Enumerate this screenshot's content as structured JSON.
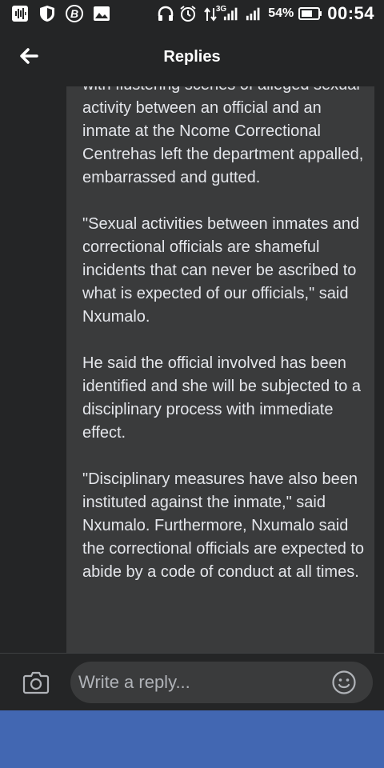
{
  "status_bar": {
    "network": "3G",
    "battery": "54%",
    "time": "00:54",
    "left_icons": [
      "sound-wave-icon",
      "shield-icon",
      "bitcoin-icon",
      "image-icon"
    ],
    "right_icons": [
      "headphones-icon",
      "alarm-icon",
      "data-arrows-icon",
      "signal-icon",
      "battery-icon"
    ]
  },
  "header": {
    "title": "Replies",
    "back_icon": "back-arrow-icon"
  },
  "comment": {
    "paragraphs": [
      "with flustering scenes of alleged sexual activity between an official and an inmate at the Ncome Correctional Centrehas left the department appalled, embarrassed and gutted.",
      "\"Sexual activities between inmates and correctional officials are shameful incidents that can never be ascribed to what is expected of our officials,\" said Nxumalo.",
      "He  said the official involved has been identified and she will be subjected to a disciplinary process with immediate effect.",
      "\"Disciplinary measures have also been instituted against the inmate,\" said Nxumalo. Furthermore, Nxumalo said the  correctional officials are expected to abide by a code of conduct at all times."
    ]
  },
  "reply_bar": {
    "placeholder": "Write a reply...",
    "camera_icon": "camera-icon",
    "emoji_icon": "emoji-icon"
  },
  "colors": {
    "background": "#242526",
    "bubble": "#3a3b3c",
    "text": "#e4e6eb",
    "bottom_panel": "#4267b2"
  }
}
